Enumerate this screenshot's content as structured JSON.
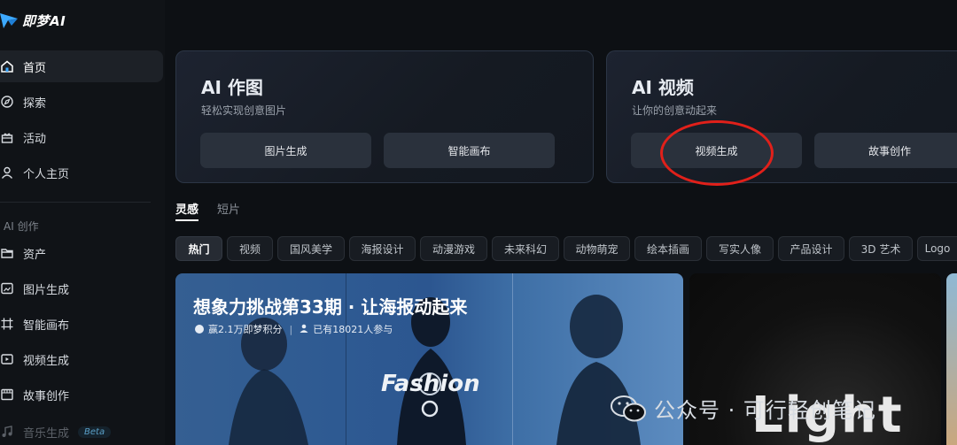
{
  "app": {
    "logo_text": "即梦AI"
  },
  "sidebar": {
    "items": [
      {
        "label": "首页",
        "icon": "home-icon"
      },
      {
        "label": "探索",
        "icon": "compass-icon"
      },
      {
        "label": "活动",
        "icon": "gift-icon"
      },
      {
        "label": "个人主页",
        "icon": "user-icon"
      }
    ],
    "section_label": "AI 创作",
    "creation_items": [
      {
        "label": "资产",
        "icon": "folder-icon"
      },
      {
        "label": "图片生成",
        "icon": "image-icon"
      },
      {
        "label": "智能画布",
        "icon": "canvas-icon"
      },
      {
        "label": "视频生成",
        "icon": "video-icon"
      },
      {
        "label": "故事创作",
        "icon": "story-icon"
      },
      {
        "label": "音乐生成",
        "icon": "music-icon",
        "badge": "Beta"
      }
    ]
  },
  "cards": [
    {
      "title": "AI 作图",
      "subtitle": "轻松实现创意图片",
      "buttons": [
        "图片生成",
        "智能画布"
      ]
    },
    {
      "title": "AI 视频",
      "subtitle": "让你的创意动起来",
      "buttons": [
        "视频生成",
        "故事创作"
      ]
    }
  ],
  "tabs": [
    "灵感",
    "短片"
  ],
  "chips": [
    "热门",
    "视频",
    "国风美学",
    "海报设计",
    "动漫游戏",
    "未来科幻",
    "动物萌宠",
    "绘本插画",
    "写实人像",
    "产品设计",
    "3D 艺术",
    "Logo"
  ],
  "banner": {
    "title": "想象力挑战第33期 · 让海报动起来",
    "reward": "赢2.1万即梦积分",
    "participants": "已有18021人参与",
    "poster_text": "Fashion"
  },
  "card2_text": "Light",
  "watermark": "公众号 · 可行轻创笔记",
  "colors": {
    "highlight_circle": "#e1201a",
    "accent": "#3da9ff"
  }
}
